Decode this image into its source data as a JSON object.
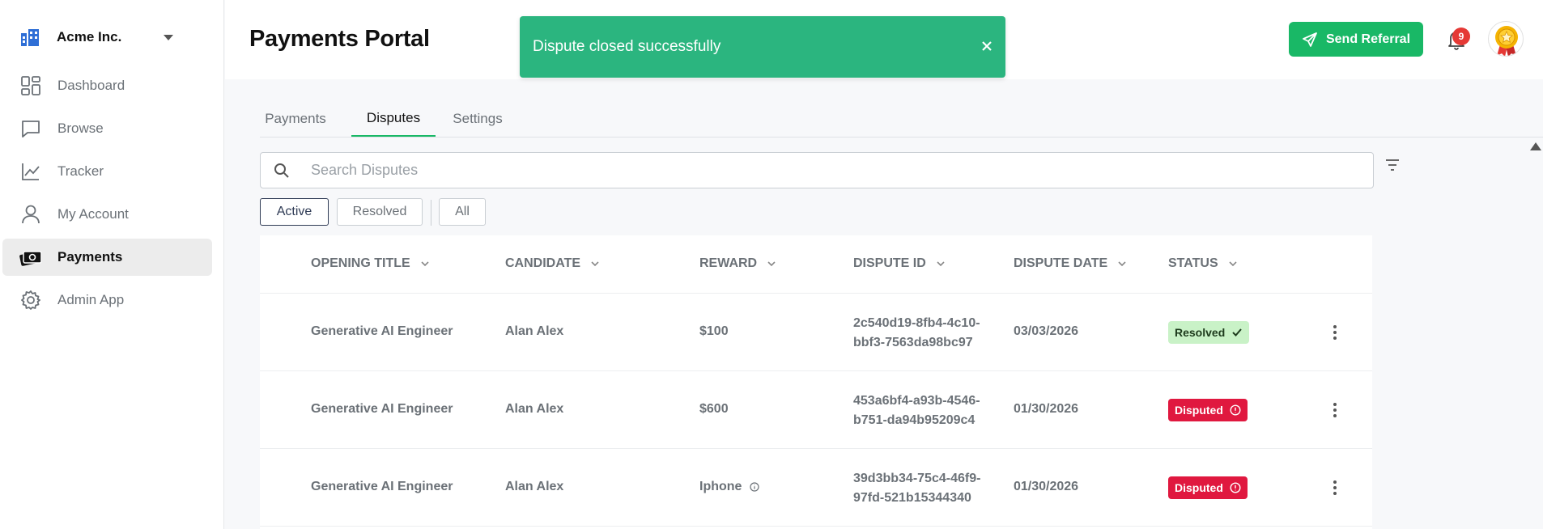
{
  "org": {
    "name": "Acme Inc."
  },
  "sidebar": {
    "items": [
      {
        "label": "Dashboard",
        "icon": "dashboard-icon"
      },
      {
        "label": "Browse",
        "icon": "chat-icon"
      },
      {
        "label": "Tracker",
        "icon": "chart-icon"
      },
      {
        "label": "My Account",
        "icon": "user-icon"
      },
      {
        "label": "Payments",
        "icon": "payments-icon",
        "active": true
      },
      {
        "label": "Admin App",
        "icon": "gear-icon"
      }
    ]
  },
  "header": {
    "title": "Payments Portal",
    "referral_label": "Send Referral",
    "notification_count": "9"
  },
  "toast": {
    "message": "Dispute closed successfully"
  },
  "tabs": [
    {
      "label": "Payments"
    },
    {
      "label": "Disputes",
      "active": true
    },
    {
      "label": "Settings"
    }
  ],
  "search": {
    "placeholder": "Search Disputes",
    "value": ""
  },
  "filters": {
    "active": "Active",
    "resolved": "Resolved",
    "all": "All",
    "selected": "Active"
  },
  "table": {
    "columns": [
      "OPENING TITLE",
      "CANDIDATE",
      "REWARD",
      "DISPUTE ID",
      "DISPUTE DATE",
      "STATUS"
    ],
    "rows": [
      {
        "title": "Generative AI Engineer",
        "candidate": "Alan Alex",
        "reward": "$100",
        "id_line1": "2c540d19-8fb4-4c10-",
        "id_line2": "bbf3-7563da98bc97",
        "date": "03/03/2026",
        "status": "Resolved"
      },
      {
        "title": "Generative AI Engineer",
        "candidate": "Alan Alex",
        "reward": "$600",
        "id_line1": "453a6bf4-a93b-4546-",
        "id_line2": "b751-da94b95209c4",
        "date": "01/30/2026",
        "status": "Disputed"
      },
      {
        "title": "Generative AI Engineer",
        "candidate": "Alan Alex",
        "reward": "Iphone",
        "id_line1": "39d3bb34-75c4-46f9-",
        "id_line2": "97fd-521b15344340",
        "date": "01/30/2026",
        "status": "Disputed"
      }
    ]
  },
  "colors": {
    "brand_green": "#19b866",
    "toast_green": "#2bb57f",
    "disputed_red": "#e0183f",
    "resolved_green_bg": "#c9f2c7"
  }
}
